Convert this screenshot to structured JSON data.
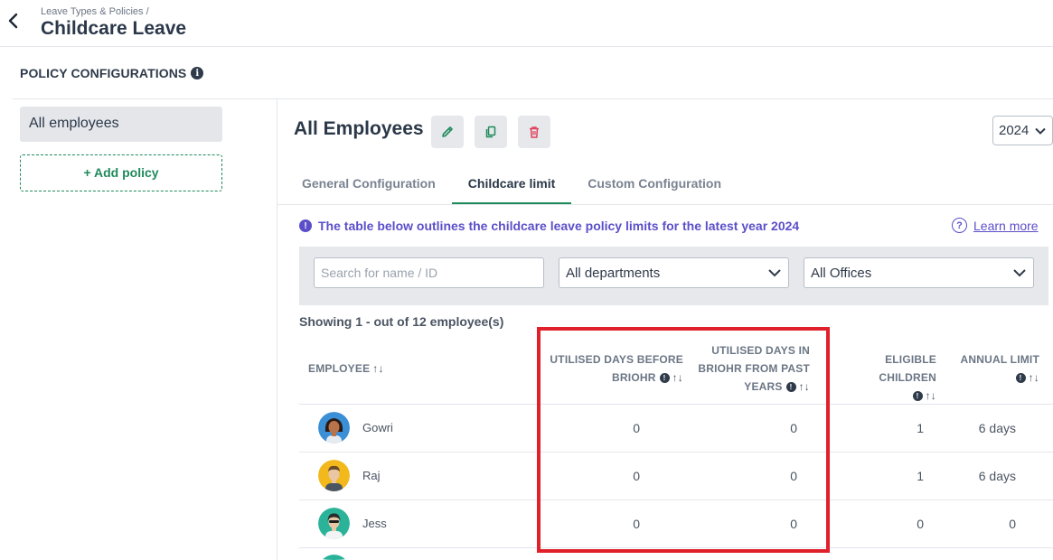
{
  "header": {
    "breadcrumb": "Leave Types & Policies  /",
    "title": "Childcare Leave"
  },
  "sidebar": {
    "section_title": "POLICY CONFIGURATIONS",
    "policies": [
      {
        "label": "All employees"
      }
    ],
    "add_policy_label": "+ Add policy"
  },
  "main": {
    "title": "All Employees",
    "year": "2024",
    "tabs": [
      {
        "label": "General Configuration"
      },
      {
        "label": "Childcare limit"
      },
      {
        "label": "Custom Configuration"
      }
    ],
    "notice": "The table below outlines the childcare leave policy limits for the latest year 2024",
    "learn_more": "Learn more"
  },
  "filters": {
    "search_placeholder": "Search for name / ID",
    "department": "All departments",
    "office": "All Offices"
  },
  "table": {
    "showing": "Showing 1 - out of 12 employee(s)",
    "columns": {
      "employee": "EMPLOYEE",
      "before_line1": "UTILISED DAYS BEFORE",
      "before_line2": "BRIOHR",
      "past_line1": "UTILISED DAYS IN",
      "past_line2": "BRIOHR FROM PAST",
      "past_line3": "YEARS",
      "eligible": "ELIGIBLE CHILDREN",
      "annual": "ANNUAL LIMIT"
    },
    "rows": [
      {
        "name": "Gowri",
        "before": "0",
        "past": "0",
        "eligible": "1",
        "annual": "6 days"
      },
      {
        "name": "Raj",
        "before": "0",
        "past": "0",
        "eligible": "1",
        "annual": "6 days"
      },
      {
        "name": "Jess",
        "before": "0",
        "past": "0",
        "eligible": "0",
        "annual": "0"
      }
    ]
  },
  "colors": {
    "accent_green": "#1f8a5c",
    "notice_purple": "#5b4fc9",
    "highlight_red": "#e0202b",
    "delete_red": "#e0405a"
  },
  "icons": [
    "back-arrow-icon",
    "info-icon",
    "pencil-icon",
    "copy-icon",
    "trash-icon",
    "chevron-down-icon",
    "question-icon",
    "sort-icon"
  ]
}
